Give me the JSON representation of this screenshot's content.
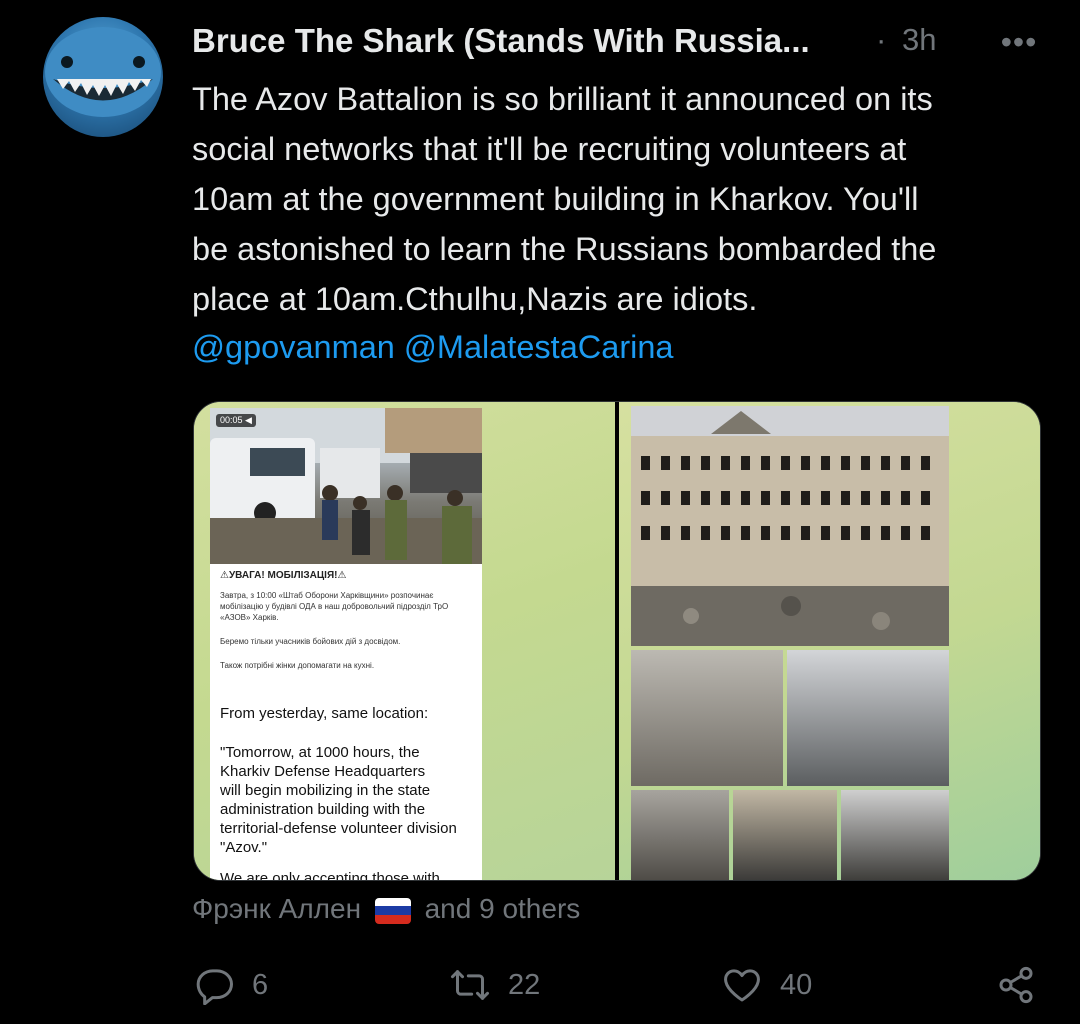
{
  "tweet": {
    "author_name": "Bruce The Shark (Stands With Russia...",
    "separator": "·",
    "time": "3h",
    "more_label": "•••",
    "text": "The Azov Battalion is so brilliant it announced on its\nsocial networks that it'll be recruiting volunteers at\n10am at the government building in Kharkov. You'll\nbe astonished to learn the Russians bombarded the\nplace at 10am.Cthulhu,Nazis are idiots.",
    "mentions": [
      "@gpovanman",
      "@MalatestaCarina"
    ]
  },
  "media": {
    "left_card": {
      "video_badge": "00:05 ◀",
      "ua_title": "⚠УВАГА! МОБІЛІЗАЦІЯ!⚠",
      "ua_line1": "Завтра, з 10:00 «Штаб Оборони Харківщини» розпочинає мобілізацію у будівлі ОДА в наш добровольчий підрозділ ТрО «АЗОВ» Харків.",
      "ua_line2": "Беремо тільки учасників бойових дій з досвідом.",
      "ua_line3": "Також потрібні жінки допомагати на кухні.",
      "en_heading": "From yesterday, same location:",
      "en_quote": "\"Tomorrow, at 1000 hours, the\nKharkiv Defense Headquarters\nwill begin mobilizing in the state\nadministration building with the\nterritorial-defense volunteer division\n\"Azov.\"",
      "en_cut": "We are only accepting those with"
    }
  },
  "social_proof": {
    "name": "Фрэнк Аллен",
    "flag_icon": "russian-flag",
    "others": "and 9 others"
  },
  "actions": {
    "replies": "6",
    "retweets": "22",
    "likes": "40"
  },
  "colors": {
    "background": "#000000",
    "text": "#e7e9ea",
    "muted": "#71767b",
    "link": "#1d9bf0"
  }
}
